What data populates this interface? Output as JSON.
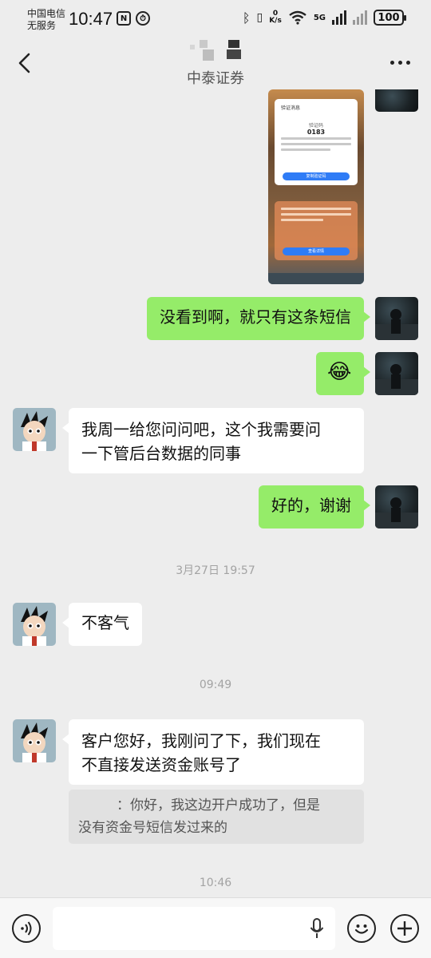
{
  "status_bar": {
    "carrier_line1": "中国电信",
    "carrier_line2": "无服务",
    "time": "10:47",
    "net_speed_value": "0",
    "net_speed_unit": "K/s",
    "network": "5G",
    "battery": "100"
  },
  "header": {
    "title": "中泰证券",
    "back_icon": "chevron-left-icon",
    "more_icon": "more-dots-icon"
  },
  "screenshot_image": {
    "card_title": "验证消息",
    "code_label": "验证码",
    "code": "0183",
    "copy_button": "复制验证码",
    "second_button": "查看详情"
  },
  "messages": [
    {
      "side": "me",
      "text": "没看到啊，就只有这条短信"
    },
    {
      "side": "me",
      "type": "emoji",
      "emoji": "😂"
    },
    {
      "side": "other",
      "text_line1": "我周一给您问问吧，这个我需要问",
      "text_line2": "一下管后台数据的同事"
    },
    {
      "side": "me",
      "text": "好的，谢谢"
    },
    {
      "side": "other",
      "text": "不客气"
    },
    {
      "side": "other",
      "text_line1": "客户您好，我刚问了下，我们现在",
      "text_line2": "不直接发送资金账号了"
    }
  ],
  "timestamps": [
    "3月27日 19:57",
    "09:49",
    "10:46"
  ],
  "quote": {
    "line1": "：你好，我这边开户成功了，但是",
    "line2": "没有资金号短信发过来的"
  },
  "input_bar": {
    "voice_icon": "voice-icon",
    "mic_icon": "microphone-icon",
    "emoji_icon": "smile-icon",
    "plus_icon": "plus-icon"
  },
  "colors": {
    "my_bubble": "#95ec69",
    "other_bubble": "#ffffff",
    "background": "#ededed"
  }
}
